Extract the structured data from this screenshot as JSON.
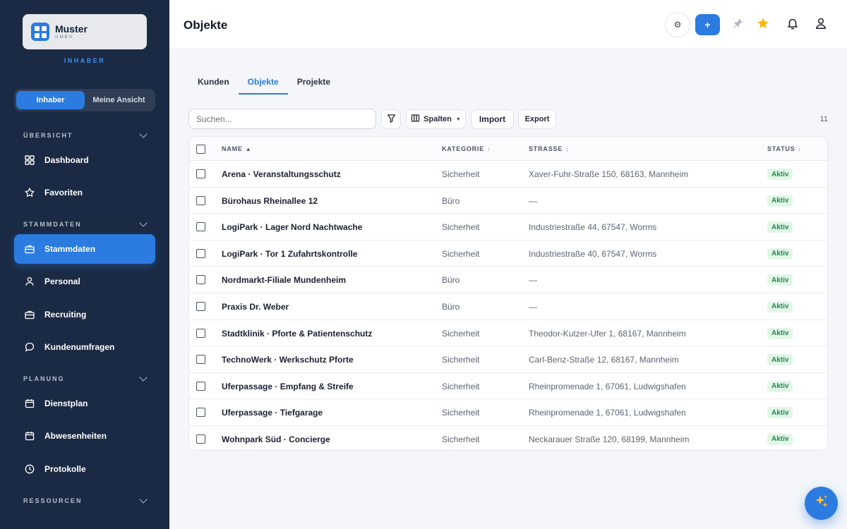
{
  "brand": {
    "name": "Muster",
    "sub": "GMBH",
    "role": "INHABER"
  },
  "view_toggle": {
    "owner": "Inhaber",
    "mine": "Meine Ansicht"
  },
  "sidebar": {
    "sections": {
      "overview": "ÜBERSICHT",
      "master": "STAMMDATEN",
      "planning": "PLANUNG",
      "resources": "RESSOURCEN"
    },
    "items": [
      {
        "label": "Dashboard",
        "icon": "grid-icon"
      },
      {
        "label": "Favoriten",
        "icon": "star-icon"
      },
      {
        "label": "Stammdaten",
        "icon": "briefcase-icon",
        "active": true
      },
      {
        "label": "Personal",
        "icon": "users-icon"
      },
      {
        "label": "Recruiting",
        "icon": "briefcase-icon"
      },
      {
        "label": "Kundenumfragen",
        "icon": "chat-icon"
      },
      {
        "label": "Dienstplan",
        "icon": "calendar-icon"
      },
      {
        "label": "Abwesenheiten",
        "icon": "calendar-icon"
      },
      {
        "label": "Protokolle",
        "icon": "clock-icon"
      }
    ]
  },
  "header": {
    "title": "Objekte",
    "add_label": "+",
    "settings_label": "⚙"
  },
  "tabs": [
    "Kunden",
    "Objekte",
    "Projekte"
  ],
  "toolbar": {
    "search_placeholder": "Suchen...",
    "columns_label": "Spalten",
    "import_label": "Import",
    "export_label": "Export",
    "count": "11"
  },
  "table": {
    "columns": {
      "name": "NAME",
      "category": "KATEGORIE",
      "street": "STRASSE",
      "status": "STATUS"
    },
    "rows": [
      {
        "name": "Arena · Veranstaltungsschutz",
        "category": "Sicherheit",
        "street": "Xaver-Fuhr-Straße 150, 68163, Mannheim",
        "status": "Aktiv"
      },
      {
        "name": "Bürohaus Rheinallee 12",
        "category": "Büro",
        "street": "—",
        "status": "Aktiv"
      },
      {
        "name": "LogiPark · Lager Nord Nachtwache",
        "category": "Sicherheit",
        "street": "Industriestraße 44, 67547, Worms",
        "status": "Aktiv"
      },
      {
        "name": "LogiPark · Tor 1 Zufahrtskontrolle",
        "category": "Sicherheit",
        "street": "Industriestraße 40, 67547, Worms",
        "status": "Aktiv"
      },
      {
        "name": "Nordmarkt-Filiale Mundenheim",
        "category": "Büro",
        "street": "—",
        "status": "Aktiv"
      },
      {
        "name": "Praxis Dr. Weber",
        "category": "Büro",
        "street": "—",
        "status": "Aktiv"
      },
      {
        "name": "Stadtklinik · Pforte & Patientenschutz",
        "category": "Sicherheit",
        "street": "Theodor-Kutzer-Ufer 1, 68167, Mannheim",
        "status": "Aktiv"
      },
      {
        "name": "TechnoWerk · Werkschutz Pforte",
        "category": "Sicherheit",
        "street": "Carl-Benz-Straße 12, 68167, Mannheim",
        "status": "Aktiv"
      },
      {
        "name": "Uferpassage · Empfang & Streife",
        "category": "Sicherheit",
        "street": "Rheinpromenade 1, 67061, Ludwigshafen",
        "status": "Aktiv"
      },
      {
        "name": "Uferpassage · Tiefgarage",
        "category": "Sicherheit",
        "street": "Rheinpromenade 1, 67061, Ludwigshafen",
        "status": "Aktiv"
      },
      {
        "name": "Wohnpark Süd · Concierge",
        "category": "Sicherheit",
        "street": "Neckarauer Straße 120, 68199, Mannheim",
        "status": "Aktiv"
      }
    ]
  },
  "colors": {
    "accent": "#2b7be0",
    "sidebar": "#1b2a44",
    "status_bg": "#e2f6e8",
    "status_fg": "#1f8a48",
    "star": "#f5b800"
  }
}
